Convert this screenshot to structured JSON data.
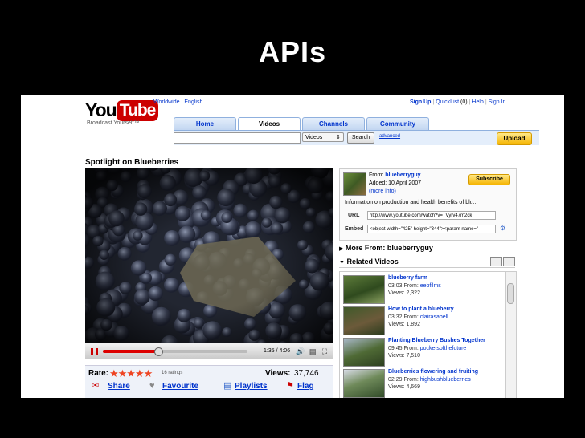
{
  "slide": {
    "title": "APIs"
  },
  "header": {
    "logo_you": "You",
    "logo_tube": "Tube",
    "tagline": "Broadcast Yourself™",
    "region_links": [
      "Worldwide",
      "English"
    ],
    "user_links": [
      "Sign Up",
      "QuickList",
      "(0)",
      "Help",
      "Sign In"
    ]
  },
  "nav": {
    "tabs": [
      "Home",
      "Videos",
      "Channels",
      "Community"
    ],
    "active_tab": "Videos"
  },
  "search": {
    "category": "Videos",
    "button_label": "Search",
    "advanced_label": "advanced",
    "upload_label": "Upload"
  },
  "video": {
    "title": "Spotlight on Blueberries",
    "time": "1:35 / 4:06",
    "progress_fraction": 0.385
  },
  "ratings": {
    "rate_label": "Rate:",
    "stars": "★★★★★",
    "ratings_count": "16 ratings",
    "views_label": "Views:",
    "views_value": "37,746"
  },
  "actions": {
    "share": "Share",
    "favourite": "Favourite",
    "playlists": "Playlists",
    "flag": "Flag"
  },
  "channel": {
    "from_label": "From:",
    "from_user": "blueberryguy",
    "added_label": "Added: 10 April 2007",
    "more_info": "(more info)",
    "subscribe_label": "Subscribe",
    "description": "Information on production and health benefits of blu...",
    "url_label": "URL",
    "url_value": "http://www.youtube.com/watch?v=TVyrv47m2ck",
    "embed_label": "Embed",
    "embed_value": "<object width=\"425\" height=\"344\"><param name=\""
  },
  "more_from": "More From: blueberryguy",
  "related": {
    "heading": "Related Videos",
    "items": [
      {
        "title": "blueberry farm",
        "duration": "03:03",
        "from_label": "From:",
        "user": "eebfilms",
        "views_label": "Views:",
        "views": "2,322"
      },
      {
        "title": "How to plant a blueberry",
        "duration": "03:32",
        "from_label": "From:",
        "user": "clairasabell",
        "views_label": "Views:",
        "views": "1,892"
      },
      {
        "title": "Planting Blueberry Bushes Together",
        "duration": "09:45",
        "from_label": "From:",
        "user": "pocketsofthefuture",
        "views_label": "Views:",
        "views": "7,510"
      },
      {
        "title": "Blueberries flowering and fruiting",
        "duration": "02:29",
        "from_label": "From:",
        "user": "highbushblueberries",
        "views_label": "Views:",
        "views": "4,669"
      }
    ]
  }
}
